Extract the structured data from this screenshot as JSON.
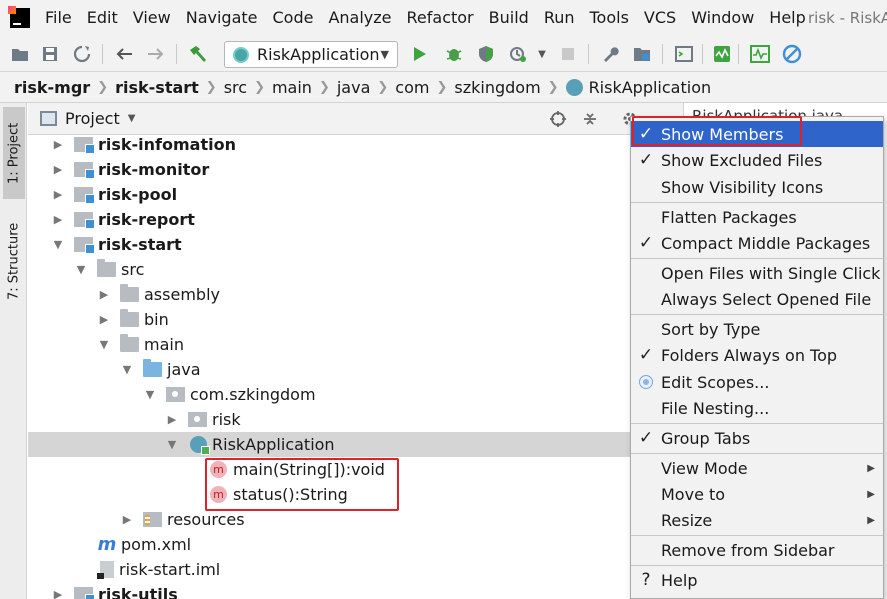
{
  "menubar": {
    "items": [
      "File",
      "Edit",
      "View",
      "Navigate",
      "Code",
      "Analyze",
      "Refactor",
      "Build",
      "Run",
      "Tools",
      "VCS",
      "Window",
      "Help"
    ],
    "window_title": "risk - RiskA"
  },
  "toolbar": {
    "run_config": "RiskApplication"
  },
  "breadcrumb": [
    "risk-mgr",
    "risk-start",
    "src",
    "main",
    "java",
    "com",
    "szkingdom",
    "RiskApplication"
  ],
  "left_stripe": {
    "project_tab": "1: Project",
    "structure_tab": "7: Structure"
  },
  "project_panel": {
    "title": "Project"
  },
  "tree": {
    "risk_infomation": "risk-infomation",
    "risk_monitor": "risk-monitor",
    "risk_pool": "risk-pool",
    "risk_report": "risk-report",
    "risk_start": "risk-start",
    "src": "src",
    "assembly": "assembly",
    "bin": "bin",
    "main": "main",
    "java": "java",
    "com_szkingdom": "com.szkingdom",
    "risk": "risk",
    "risk_application": "RiskApplication",
    "method_main": "main(String[]):void",
    "method_status": "status():String",
    "resources": "resources",
    "pom": "pom.xml",
    "iml": "risk-start.iml",
    "risk_utils": "risk-utils"
  },
  "editor": {
    "tab": "RiskApplication.java"
  },
  "context_menu": {
    "show_members": "Show Members",
    "show_excluded_files": "Show Excluded Files",
    "show_visibility_icons": "Show Visibility Icons",
    "flatten_packages": "Flatten Packages",
    "compact_middle_packages": "Compact Middle Packages",
    "open_files_single_click": "Open Files with Single Click",
    "always_select_opened_file": "Always Select Opened File",
    "sort_by_type": "Sort by Type",
    "folders_always_on_top": "Folders Always on Top",
    "edit_scopes": "Edit Scopes...",
    "file_nesting": "File Nesting...",
    "group_tabs": "Group Tabs",
    "view_mode": "View Mode",
    "move_to": "Move to",
    "resize": "Resize",
    "remove_from_sidebar": "Remove from Sidebar",
    "help": "Help"
  },
  "colors": {
    "highlight": "#2f65ca",
    "annotation_box": "#e0202a"
  }
}
